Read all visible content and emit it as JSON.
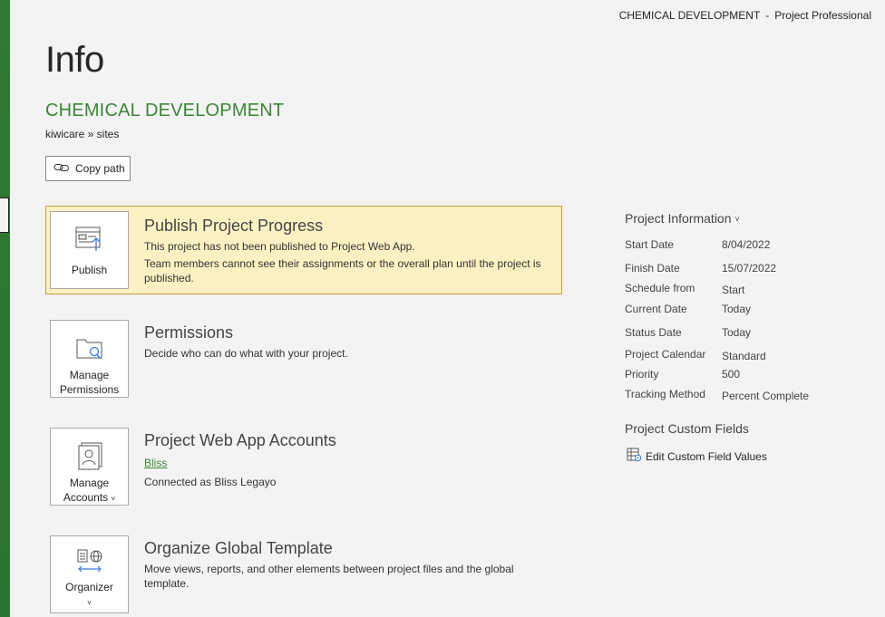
{
  "window": {
    "doc_title": "CHEMICAL DEVELOPMENT",
    "separator": "-",
    "app_name": "Project Professional"
  },
  "page": {
    "title": "Info",
    "document_name": "CHEMICAL DEVELOPMENT",
    "path": "kiwicare » sites",
    "copy_path_label": "Copy path"
  },
  "sections": {
    "publish": {
      "tile_label": "Publish",
      "icon": "publish-icon",
      "title": "Publish Project Progress",
      "line1": "This project has not been published to Project Web App.",
      "line2": "Team members cannot see their assignments or the overall plan until the project is published."
    },
    "permissions": {
      "tile_label_1": "Manage",
      "tile_label_2": "Permissions",
      "icon": "manage-permissions-icon",
      "title": "Permissions",
      "line1": "Decide who can do what with your project."
    },
    "accounts": {
      "tile_label_1": "Manage",
      "tile_label_2": "Accounts",
      "icon": "manage-accounts-icon",
      "title": "Project Web App Accounts",
      "link": "Bliss",
      "line1": "Connected as Bliss Legayo"
    },
    "organizer": {
      "tile_label": "Organizer",
      "icon": "organizer-icon",
      "title": "Organize Global Template",
      "line1": "Move views, reports, and other elements between project files and the global template."
    }
  },
  "project_info": {
    "heading": "Project Information",
    "fields": [
      {
        "label": "Start Date",
        "value": "8/04/2022"
      },
      {
        "label": "Finish Date",
        "value": "15/07/2022"
      },
      {
        "label": "Schedule from",
        "value": "Start"
      },
      {
        "label": "Current Date",
        "value": "Today"
      },
      {
        "label": "Status Date",
        "value": "Today"
      },
      {
        "label": "Project Calendar",
        "value": "Standard"
      },
      {
        "label": "Priority",
        "value": "500"
      },
      {
        "label": "Tracking Method",
        "value": "Percent Complete"
      }
    ],
    "custom_heading": "Project Custom Fields",
    "edit_custom_label": "Edit Custom Field Values"
  },
  "colors": {
    "accent_green": "#3c8538",
    "highlight_bg": "#fdf1c3",
    "highlight_border": "#c69b43"
  }
}
